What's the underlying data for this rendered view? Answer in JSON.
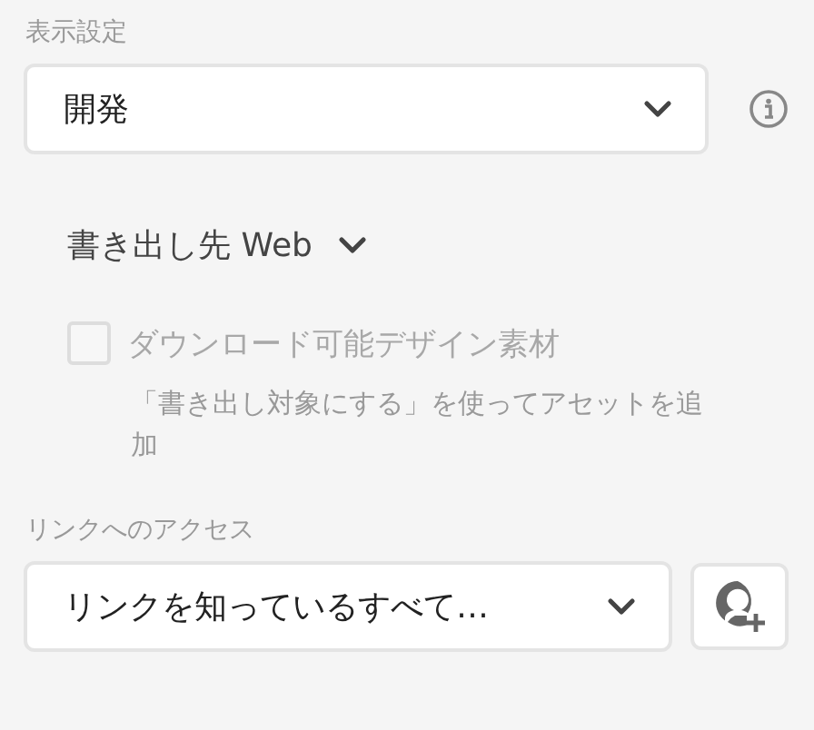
{
  "display_settings": {
    "label": "表示設定",
    "dropdown": {
      "value": "開発"
    }
  },
  "export_target": {
    "label": "書き出し先 Web"
  },
  "download_assets": {
    "label": "ダウンロード可能デザイン素材",
    "checked": false,
    "disabled": true
  },
  "hint": "「書き出し対象にする」を使ってアセットを追加",
  "link_access": {
    "label": "リンクへのアクセス",
    "dropdown": {
      "value": "リンクを知っているすべて…"
    }
  }
}
